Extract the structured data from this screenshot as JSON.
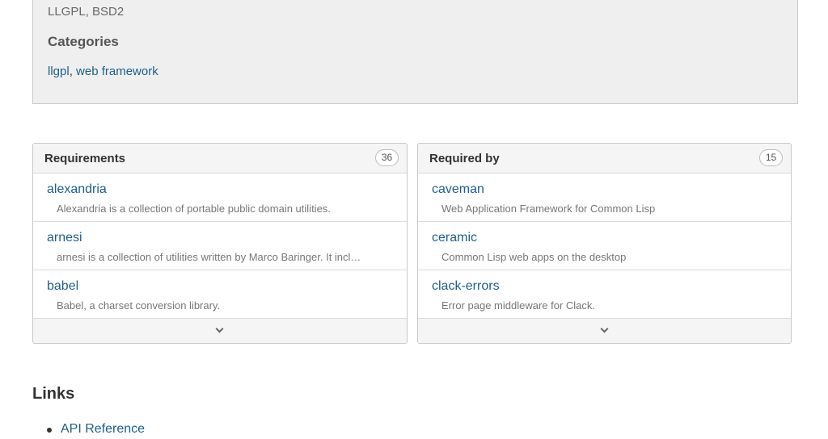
{
  "info": {
    "license": "LLGPL, BSD2",
    "categories_heading": "Categories",
    "categories": [
      {
        "label": "llgpl"
      },
      {
        "label": "web framework"
      }
    ],
    "separator": ", "
  },
  "requirements": {
    "title": "Requirements",
    "count": "36",
    "items": [
      {
        "name": "alexandria",
        "description": "Alexandria is a collection of portable public domain utilities."
      },
      {
        "name": "arnesi",
        "description": "arnesi is a collection of utilities written by Marco Baringer. It incl…"
      },
      {
        "name": "babel",
        "description": "Babel, a charset conversion library."
      }
    ],
    "expand_icon": "chevron-down-icon"
  },
  "required_by": {
    "title": "Required by",
    "count": "15",
    "items": [
      {
        "name": "caveman",
        "description": "Web Application Framework for Common Lisp"
      },
      {
        "name": "ceramic",
        "description": "Common Lisp web apps on the desktop"
      },
      {
        "name": "clack-errors",
        "description": "Error page middleware for Clack."
      }
    ],
    "expand_icon": "chevron-down-icon"
  },
  "links": {
    "heading": "Links",
    "items": [
      {
        "label": "API Reference"
      }
    ]
  },
  "colors": {
    "link": "#1e5f8c",
    "info_background": "#efefef",
    "panel_heading_background": "#f5f5f5"
  }
}
